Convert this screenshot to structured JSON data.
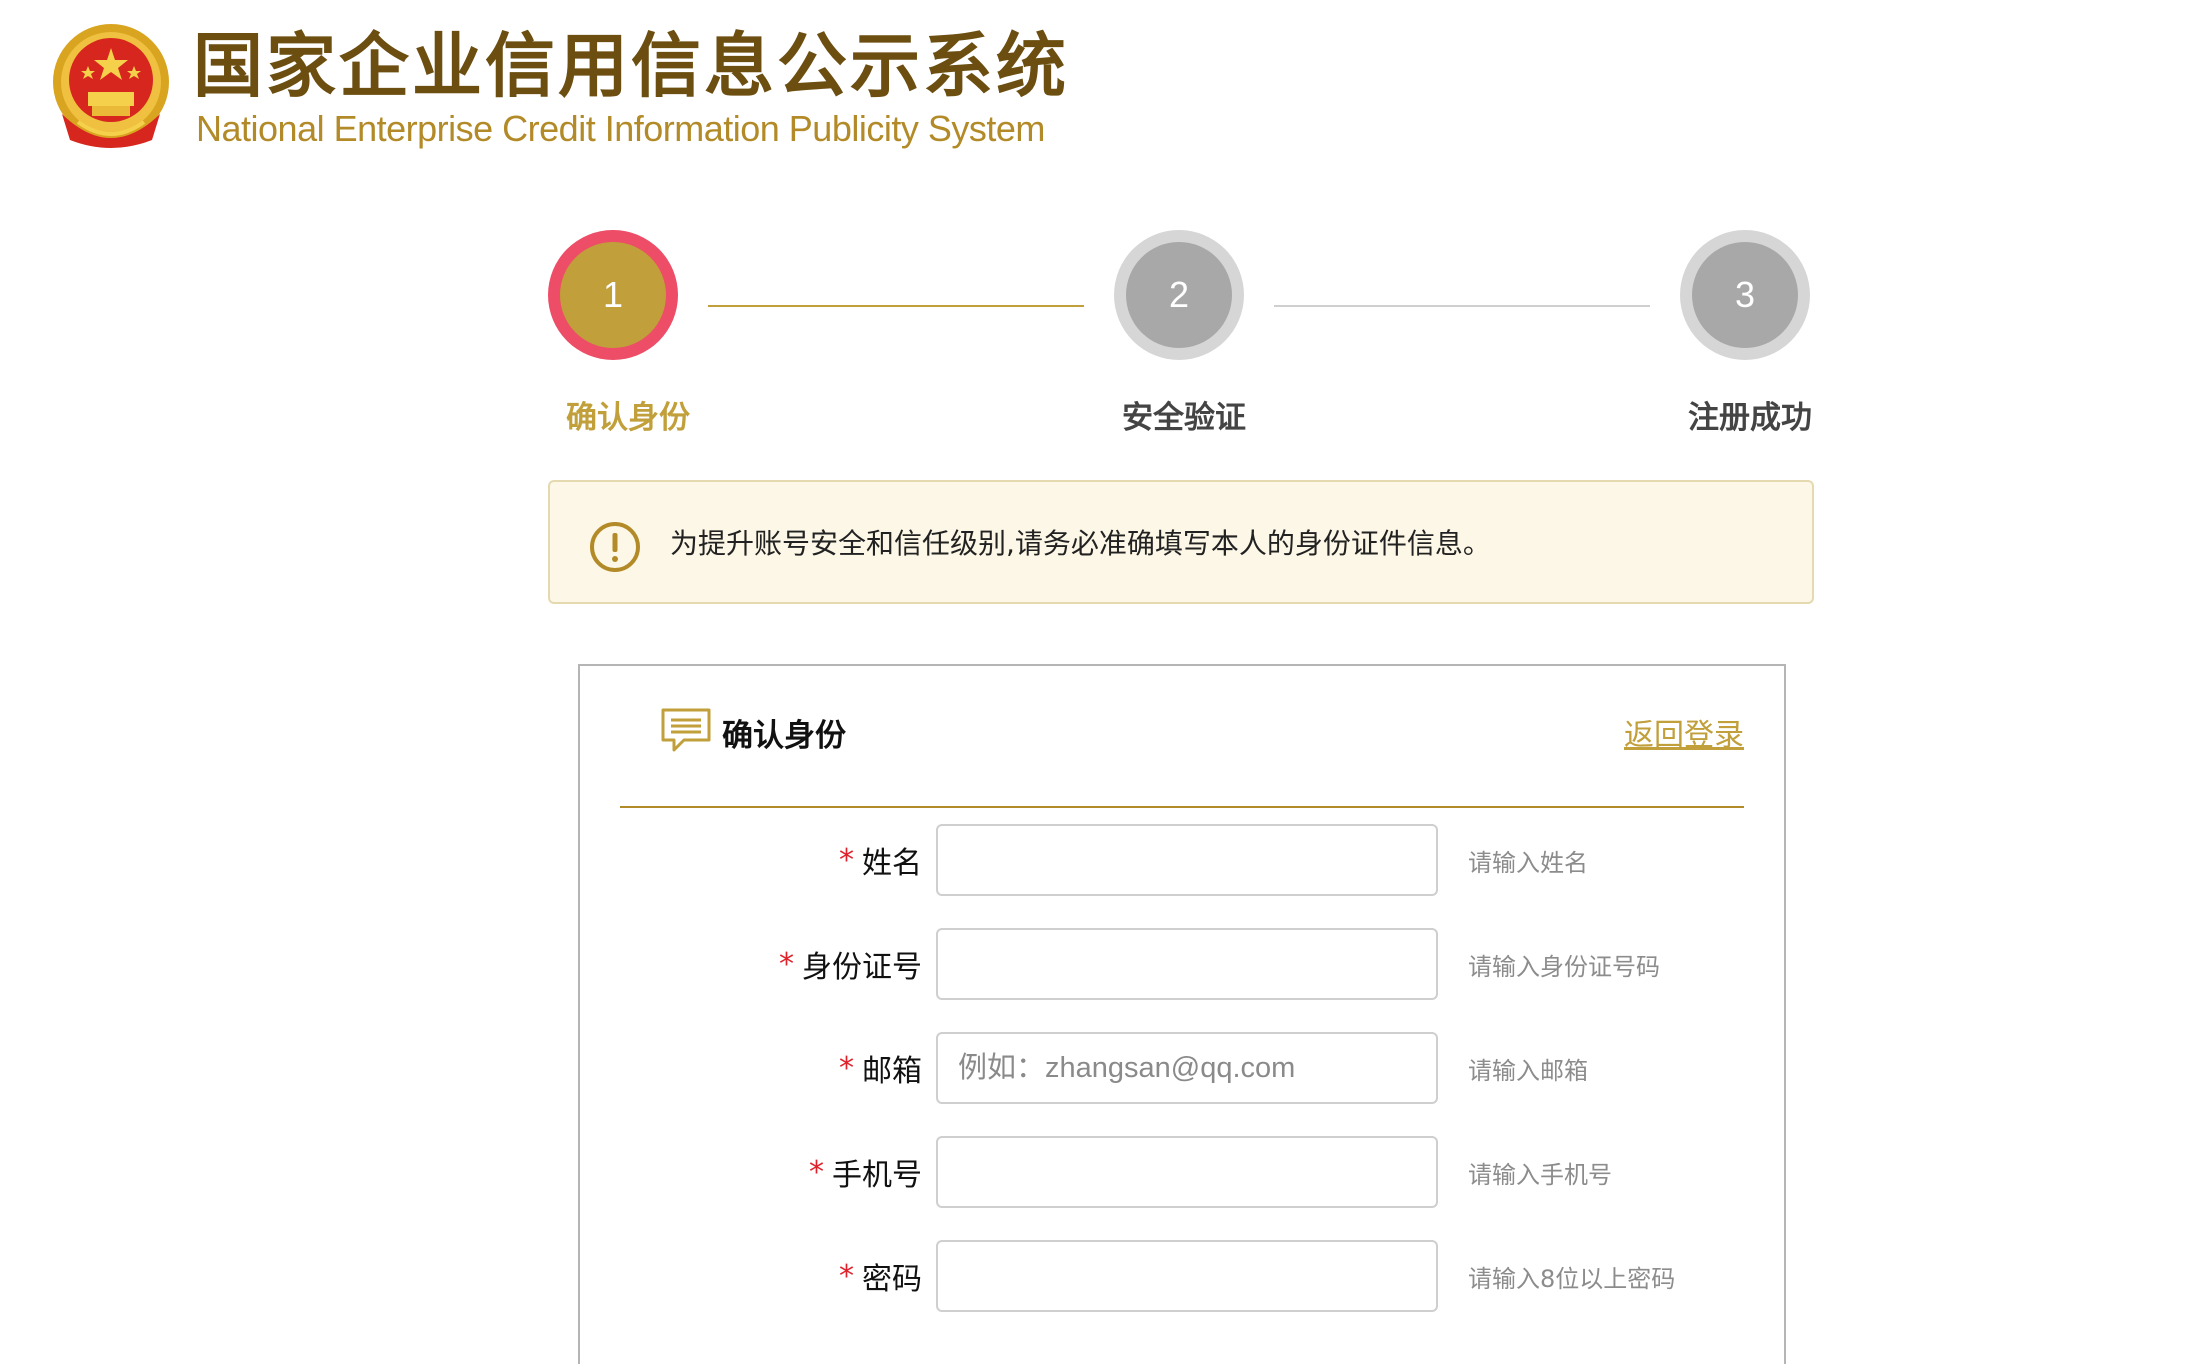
{
  "header": {
    "title_cn": "国家企业信用信息公示系统",
    "title_en": "National Enterprise Credit Information Publicity System",
    "emblem_icon": "national-emblem-icon"
  },
  "steps": [
    {
      "number": "1",
      "label": "确认身份",
      "state": "active"
    },
    {
      "number": "2",
      "label": "安全验证",
      "state": "todo"
    },
    {
      "number": "3",
      "label": "注册成功",
      "state": "todo"
    }
  ],
  "notice": {
    "icon": "exclamation-circle-icon",
    "text": "为提升账号安全和信任级别,请务必准确填写本人的身份证件信息。"
  },
  "form": {
    "icon": "message-lines-icon",
    "title": "确认身份",
    "back_link": "返回登录",
    "fields": [
      {
        "label": "姓名",
        "required_mark": "*",
        "value": "",
        "placeholder": "",
        "hint": "请输入姓名"
      },
      {
        "label": "身份证号",
        "required_mark": "*",
        "value": "",
        "placeholder": "",
        "hint": "请输入身份证号码"
      },
      {
        "label": "邮箱",
        "required_mark": "*",
        "value": "",
        "placeholder": "例如：zhangsan@qq.com",
        "hint": "请输入邮箱"
      },
      {
        "label": "手机号",
        "required_mark": "*",
        "value": "",
        "placeholder": "",
        "hint": "请输入手机号"
      },
      {
        "label": "密码",
        "required_mark": "*",
        "value": "",
        "placeholder": "",
        "hint": "请输入8位以上密码"
      }
    ]
  },
  "colors": {
    "brand_gold": "#c19f3a",
    "brand_brown": "#6b4e10",
    "active_ring": "#ed4d66",
    "inactive_step": "#a8a8a8",
    "required_red": "#e0212a",
    "notice_bg": "#fcf7e6"
  }
}
